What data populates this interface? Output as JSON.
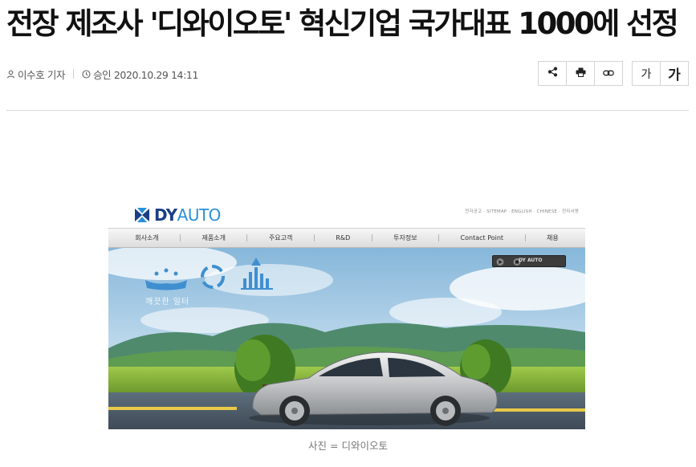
{
  "article": {
    "headline": "전장 제조사 '디와이오토' 혁신기업 국가대표 1000에 선정",
    "author": "이수호 기자",
    "approved": "승인 2020.10.29 14:11",
    "caption": "사진 = 디와이오토"
  },
  "toolbar": {
    "share_icon": "share-icon",
    "print_icon": "print-icon",
    "link_icon": "link-icon",
    "font_small": "가",
    "font_large": "가"
  },
  "image": {
    "logo_dy": "DY",
    "logo_auto": "AUTO",
    "util_links": "전자공고 · SITEMAP · ENGLISH · CHINESE · 전자서명",
    "nav_items": [
      "회사소개",
      "제품소개",
      "주요고객",
      "R&D",
      "투자정보",
      "Contact Point",
      "채용"
    ],
    "player_label": "DY AUTO",
    "scene_label": "깨끗한 일터"
  }
}
